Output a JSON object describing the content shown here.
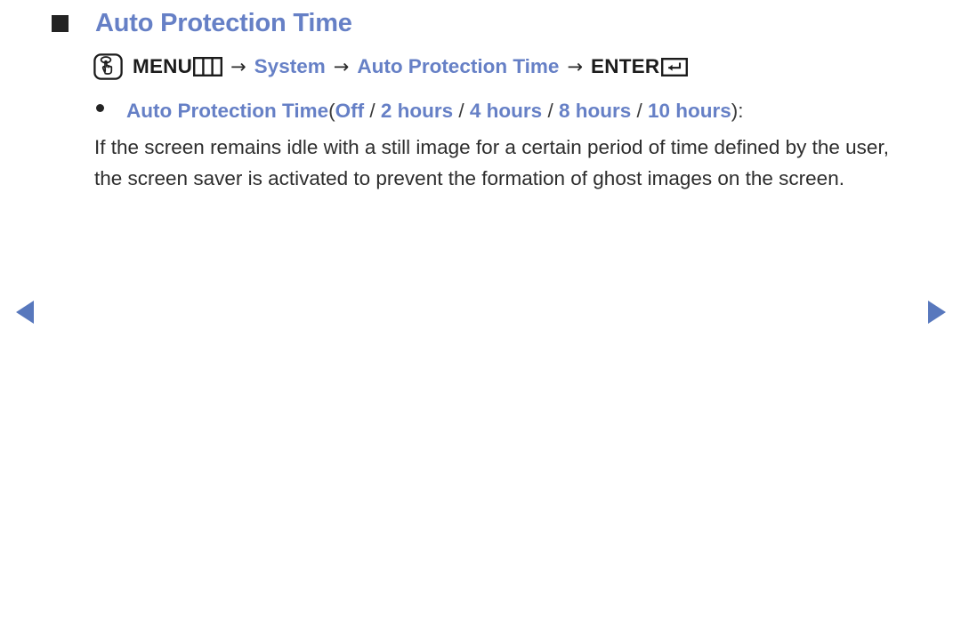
{
  "page": {
    "title": "Auto Protection Time",
    "title_bullet_icon": "square-bullet-icon",
    "accent_color": "#6680c6",
    "text_color": "#2d2d2d"
  },
  "menu_path": {
    "touch_icon": "hand-press-button-icon",
    "menu_label": "MENU",
    "menu_grid_icon": "menu-grid-icon",
    "arrow": "→",
    "step_system": "System",
    "step_feature": "Auto Protection Time",
    "enter_label": "ENTER",
    "enter_icon": "return-key-icon"
  },
  "option_line": {
    "bullet_icon": "round-bullet-icon",
    "label": "Auto Protection Time",
    "open_paren": "(",
    "close_paren": ")",
    "colon": ":",
    "separator": "/",
    "options": [
      "Off",
      "2 hours",
      "4 hours",
      "8 hours",
      "10 hours"
    ]
  },
  "body": {
    "paragraph": "If the screen remains idle with a still image for a certain period of time defined by the user, the screen saver is activated to prevent the formation of ghost images on the screen."
  },
  "navigation": {
    "prev_icon": "triangle-left-icon",
    "next_icon": "triangle-right-icon",
    "arrow_color": "#5878bd"
  }
}
